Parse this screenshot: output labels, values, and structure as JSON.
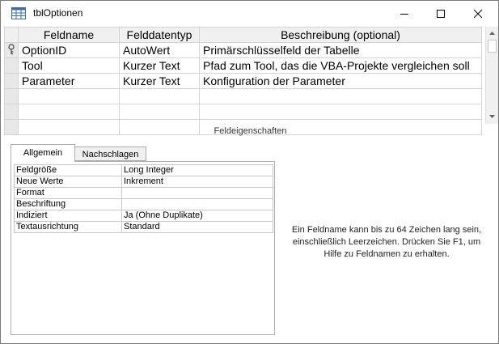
{
  "window": {
    "title": "tblOptionen"
  },
  "design_grid": {
    "headers": [
      "Feldname",
      "Felddatentyp",
      "Beschreibung (optional)"
    ],
    "rows": [
      {
        "name": "OptionID",
        "type": "AutoWert",
        "description": "Primärschlüsselfeld der Tabelle",
        "primary_key": true
      },
      {
        "name": "Tool",
        "type": "Kurzer Text",
        "description": "Pfad zum Tool, das die VBA-Projekte vergleichen soll",
        "primary_key": false
      },
      {
        "name": "Parameter",
        "type": "Kurzer Text",
        "description": "Konfiguration der Parameter",
        "primary_key": false
      }
    ]
  },
  "field_properties": {
    "section_label": "Feldeigenschaften",
    "tabs": [
      "Allgemein",
      "Nachschlagen"
    ],
    "active_tab": "Allgemein",
    "rows": [
      {
        "label": "Feldgröße",
        "value": "Long Integer"
      },
      {
        "label": "Neue Werte",
        "value": "Inkrement"
      },
      {
        "label": "Format",
        "value": ""
      },
      {
        "label": "Beschriftung",
        "value": ""
      },
      {
        "label": "Indiziert",
        "value": "Ja (Ohne Duplikate)"
      },
      {
        "label": "Textausrichtung",
        "value": "Standard"
      }
    ]
  },
  "help_text": "Ein Feldname kann bis zu 64 Zeichen lang sein, einschließlich Leerzeichen. Drücken Sie F1, um Hilfe zu Feldnamen zu erhalten.",
  "icons": {
    "window": "table-icon",
    "primary_key": "key-icon"
  }
}
